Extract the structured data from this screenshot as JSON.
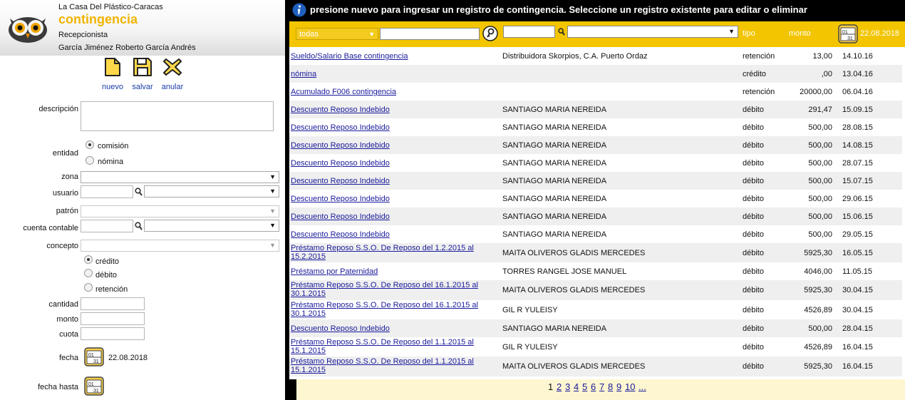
{
  "header": {
    "company": "La Casa Del Plástico-Caracas",
    "module": "contingencia",
    "role": "Recepcionista",
    "user": "García Jiménez Roberto García Andrés"
  },
  "toolbar": {
    "new_label": "nuevo",
    "save_label": "salvar",
    "cancel_label": "anular"
  },
  "form": {
    "descripcion_label": "descripción",
    "entidad_label": "entidad",
    "entidad_options": [
      "comisión",
      "nómina"
    ],
    "entidad_selected": "comisión",
    "zona_label": "zona",
    "usuario_label": "usuario",
    "patron_label": "patrón",
    "cuenta_label": "cuenta contable",
    "concepto_label": "concepto",
    "tipo_options": [
      "crédito",
      "débito",
      "retención"
    ],
    "tipo_selected": "crédito",
    "cantidad_label": "cantidad",
    "monto_label": "monto",
    "cuota_label": "cuota",
    "fecha_label": "fecha",
    "fecha_value": "22.08.2018",
    "fecha_hasta_label": "fecha hasta"
  },
  "info": {
    "message": "presione nuevo para ingresar un registro de contingencia. Seleccione un registro existente para editar o eliminar"
  },
  "filter": {
    "scope_value": "todas",
    "tipo_header": "tipo",
    "monto_header": "monto",
    "date": "22.08.2018"
  },
  "rows": [
    {
      "desc": "Sueldo/Salario Base contingencia",
      "entity": "Distribuidora Skorpios, C.A. Puerto Ordaz",
      "tipo": "retención",
      "monto": "13,00",
      "fecha": "14.10.16"
    },
    {
      "desc": "nómina",
      "entity": "",
      "tipo": "crédito",
      "monto": ",00",
      "fecha": "13.04.16"
    },
    {
      "desc": "Acumulado F006 contingencia",
      "entity": "",
      "tipo": "retención",
      "monto": "20000,00",
      "fecha": "06.04.16"
    },
    {
      "desc": "Descuento Reposo Indebido",
      "entity": "SANTIAGO MARIA NEREIDA",
      "tipo": "débito",
      "monto": "291,47",
      "fecha": "15.09.15"
    },
    {
      "desc": "Descuento Reposo Indebido",
      "entity": "SANTIAGO MARIA NEREIDA",
      "tipo": "débito",
      "monto": "500,00",
      "fecha": "28.08.15"
    },
    {
      "desc": "Descuento Reposo Indebido",
      "entity": "SANTIAGO MARIA NEREIDA",
      "tipo": "débito",
      "monto": "500,00",
      "fecha": "14.08.15"
    },
    {
      "desc": "Descuento Reposo Indebido",
      "entity": "SANTIAGO MARIA NEREIDA",
      "tipo": "débito",
      "monto": "500,00",
      "fecha": "28.07.15"
    },
    {
      "desc": "Descuento Reposo Indebido",
      "entity": "SANTIAGO MARIA NEREIDA",
      "tipo": "débito",
      "monto": "500,00",
      "fecha": "15.07.15"
    },
    {
      "desc": "Descuento Reposo Indebido",
      "entity": "SANTIAGO MARIA NEREIDA",
      "tipo": "débito",
      "monto": "500,00",
      "fecha": "29.06.15"
    },
    {
      "desc": "Descuento Reposo Indebido",
      "entity": "SANTIAGO MARIA NEREIDA",
      "tipo": "débito",
      "monto": "500,00",
      "fecha": "15.06.15"
    },
    {
      "desc": "Descuento Reposo Indebido",
      "entity": "SANTIAGO MARIA NEREIDA",
      "tipo": "débito",
      "monto": "500,00",
      "fecha": "29.05.15"
    },
    {
      "desc": "Préstamo Reposo S.S.O. De Reposo del 1.2.2015 al 15.2.2015",
      "entity": "MAITA OLIVEROS GLADIS MERCEDES",
      "tipo": "débito",
      "monto": "5925,30",
      "fecha": "16.05.15"
    },
    {
      "desc": "Préstamo por Paternidad",
      "entity": "TORRES RANGEL JOSE MANUEL",
      "tipo": "débito",
      "monto": "4046,00",
      "fecha": "11.05.15"
    },
    {
      "desc": "Préstamo Reposo S.S.O. De Reposo del 16.1.2015 al 30.1.2015",
      "entity": "MAITA OLIVEROS GLADIS MERCEDES",
      "tipo": "débito",
      "monto": "5925,30",
      "fecha": "30.04.15"
    },
    {
      "desc": "Préstamo Reposo S.S.O. De Reposo del 16.1.2015 al 30.1.2015",
      "entity": "GIL R YULEISY",
      "tipo": "débito",
      "monto": "4526,89",
      "fecha": "30.04.15"
    },
    {
      "desc": "Descuento Reposo Indebido",
      "entity": "SANTIAGO MARIA NEREIDA",
      "tipo": "débito",
      "monto": "500,00",
      "fecha": "28.04.15"
    },
    {
      "desc": "Préstamo Reposo S.S.O. De Reposo del 1.1.2015 al 15.1.2015",
      "entity": "GIL R YULEISY",
      "tipo": "débito",
      "monto": "4526,89",
      "fecha": "16.04.15"
    },
    {
      "desc": "Préstamo Reposo S.S.O. De Reposo del 1.1.2015 al 15.1.2015",
      "entity": "MAITA OLIVEROS GLADIS MERCEDES",
      "tipo": "débito",
      "monto": "5925,30",
      "fecha": "16.04.15"
    }
  ],
  "pagination": {
    "pages": [
      "1",
      "2",
      "3",
      "4",
      "5",
      "6",
      "7",
      "8",
      "9",
      "10",
      "..."
    ],
    "current": "1"
  },
  "colors": {
    "accent": "#f2c500",
    "link": "#1a1a9c",
    "module_title": "#f0b400"
  },
  "icons": {
    "brand": "owl-logo",
    "info": "info-icon",
    "search": "key-search-icon",
    "calendar": "calendar-icon"
  }
}
